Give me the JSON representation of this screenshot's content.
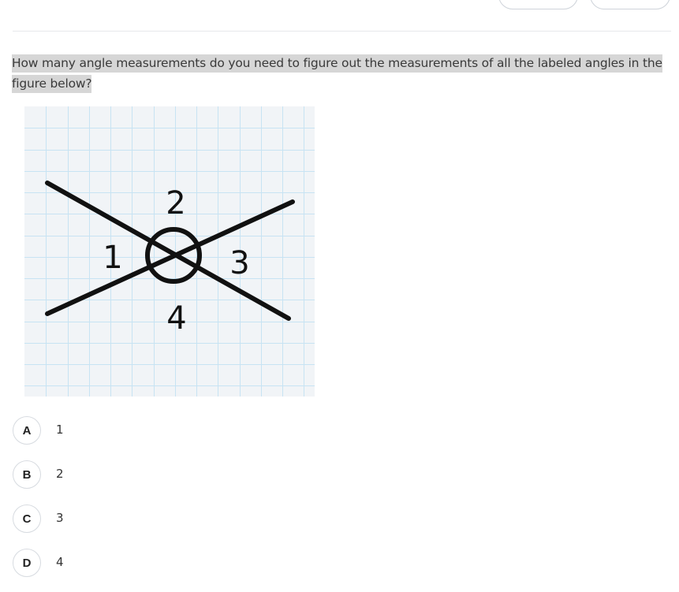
{
  "question": {
    "text": "How many angle measurements do you need to figure out the measurements of all the labeled angles in the figure below?"
  },
  "figure": {
    "angle_labels": [
      "1",
      "2",
      "3",
      "4"
    ],
    "grid_color": "#c7e3f3",
    "line_color": "#111111"
  },
  "choices": [
    {
      "letter": "A",
      "text": "1"
    },
    {
      "letter": "B",
      "text": "2"
    },
    {
      "letter": "C",
      "text": "3"
    },
    {
      "letter": "D",
      "text": "4"
    }
  ]
}
